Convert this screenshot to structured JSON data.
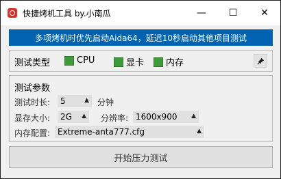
{
  "window": {
    "title": "快捷烤机工具 by.小南瓜",
    "minimize_glyph": "—",
    "maximize_glyph": "☐",
    "close_glyph": "✕"
  },
  "banner": {
    "text": "多项烤机时优先启动Aida64，延迟10秒启动其他项目测试",
    "color": "#0063b1"
  },
  "test_type": {
    "label": "测试类型",
    "options": [
      {
        "label": "CPU",
        "checked": true
      },
      {
        "label": "显卡",
        "checked": true
      },
      {
        "label": "内存",
        "checked": true
      }
    ],
    "pin_icon": "pin-icon",
    "check_color": "#3f9a3a"
  },
  "params": {
    "title": "测试参数",
    "duration_label": "测试时长:",
    "duration_value": "5",
    "duration_unit": "分钟",
    "vram_label": "显存大小:",
    "vram_value": "2G",
    "resolution_label": "分辨率:",
    "resolution_value": "1600x900",
    "memory_config_label": "内存配置:",
    "memory_config_value": "Extreme-anta777.cfg",
    "arrow_glyph": "▲"
  },
  "actions": {
    "start_label": "开始压力测试"
  }
}
